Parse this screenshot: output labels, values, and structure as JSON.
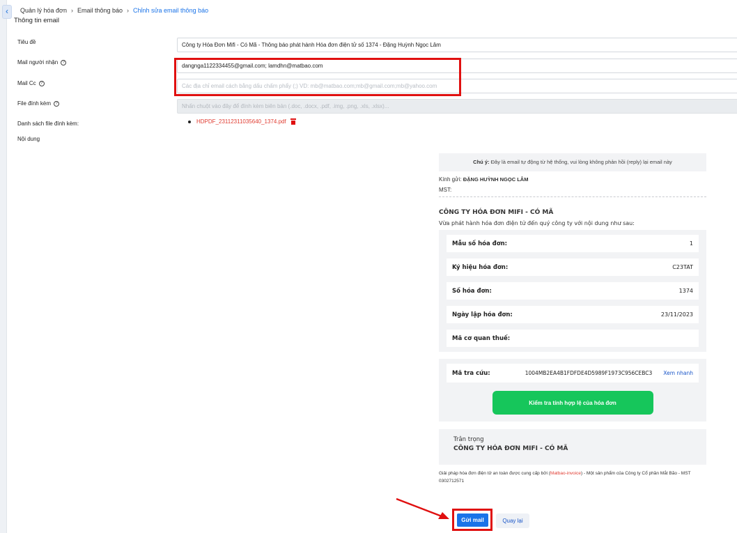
{
  "breadcrumb": {
    "items": [
      "Quản lý hóa đơn",
      "Email thông báo"
    ],
    "current": "Chỉnh sửa email thông báo"
  },
  "section_title": "Thông tin email",
  "form": {
    "subject_label": "Tiêu đề",
    "subject_value": "Công ty Hóa Đơn Mifi - Có Mã - Thông báo phát hành Hóa đơn điện tử số 1374 - Đặng Huỳnh Ngọc Lâm",
    "recipients_label": "Mail người nhận",
    "recipients_value": "dangnga1122334455@gmail.com; lamdhn@matbao.com",
    "cc_label": "Mail Cc",
    "cc_placeholder": "Các địa chỉ email cách bằng dấu chấm phẩy (;) VD: mb@matbao.com;mb@gmail.com;mb@yahoo.com",
    "attachment_label": "File đính kèm",
    "attachment_placeholder": "Nhấn chuột vào đây để đính kèm biên bản (.doc, .docx, .pdf, .img, .png, .xls, .xlsx)...",
    "attachment_list_label": "Danh sách file đính kèm:",
    "attachment_file": "HDPDF_23112311035640_1374.pdf",
    "content_label": "Nội dung"
  },
  "email_preview": {
    "note_bold": "Chú ý:",
    "note_text": "Đây là email tự động từ hệ thống, vui lòng không phản hồi (reply) lại email này",
    "greeting_label": "Kính gửi:",
    "greeting_name": "ĐẶNG HUỲNH NGỌC LÂM",
    "tax_code_label": "MST:",
    "company": "CÔNG TY HÓA ĐƠN MIFI - CÓ MÃ",
    "intro": "Vừa phát hành hóa đơn điện tử đến quý công ty với nội dung như sau:",
    "details": [
      {
        "label": "Mẫu số hóa đơn:",
        "value": "1"
      },
      {
        "label": "Ký hiệu hóa đơn:",
        "value": "C23TAT"
      },
      {
        "label": "Số hóa đơn:",
        "value": "1374"
      },
      {
        "label": "Ngày lập hóa đơn:",
        "value": "23/11/2023"
      },
      {
        "label": "Mã cơ quan thuế:",
        "value": ""
      }
    ],
    "lookup_label": "Mã tra cứu:",
    "lookup_code": "1004MB2EA4B1FDFDE4D5989F1973C956CEBC3",
    "lookup_link": "Xem nhanh",
    "verify_button": "Kiểm tra tính hợp lệ của hóa đơn",
    "regards": "Trân trọng",
    "regards_company": "CÔNG TY HÓA ĐƠN MIFI - CÓ MÃ",
    "footer_pre": "Giải pháp hóa đơn điện tử an toàn được cung cấp bởi (",
    "footer_brand": "Matbao-invoice",
    "footer_post": ") - Một sản phẩm của Công ty Cổ phần Mắt Bão - MST 0302712571"
  },
  "actions": {
    "send": "Gửi mail",
    "back": "Quay lại"
  },
  "colors": {
    "primary": "#1a73e8",
    "highlight": "#e01010",
    "success": "#16c65b",
    "link_red": "#e03c31"
  }
}
